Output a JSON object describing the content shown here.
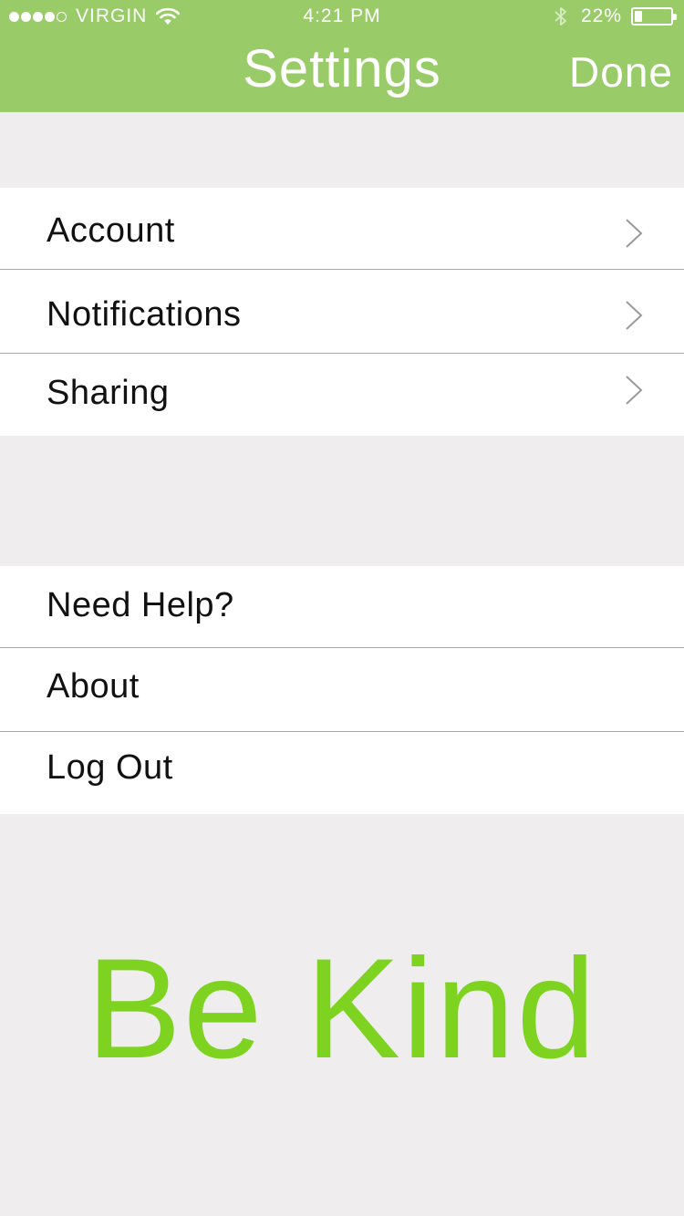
{
  "status_bar": {
    "signal_filled": 4,
    "signal_total": 5,
    "carrier": "VIRGIN",
    "time": "4:21 PM",
    "battery_percent": "22%",
    "battery_level": 0.22,
    "icons": [
      "wifi-icon",
      "bluetooth-icon",
      "battery-icon"
    ]
  },
  "nav": {
    "title": "Settings",
    "done_label": "Done"
  },
  "groups": [
    {
      "items": [
        {
          "label": "Account",
          "chevron": true
        },
        {
          "label": "Notifications",
          "chevron": true
        },
        {
          "label": "Sharing",
          "chevron": true
        }
      ]
    },
    {
      "items": [
        {
          "label": "Need Help?",
          "chevron": false
        },
        {
          "label": "About",
          "chevron": false
        },
        {
          "label": "Log Out",
          "chevron": false
        }
      ]
    }
  ],
  "tagline": "Be Kind",
  "colors": {
    "header": "#99cc68",
    "background": "#efedee",
    "tagline": "#7ed321",
    "separator": "#a9a9a9",
    "chevron": "#9a9a9a"
  }
}
